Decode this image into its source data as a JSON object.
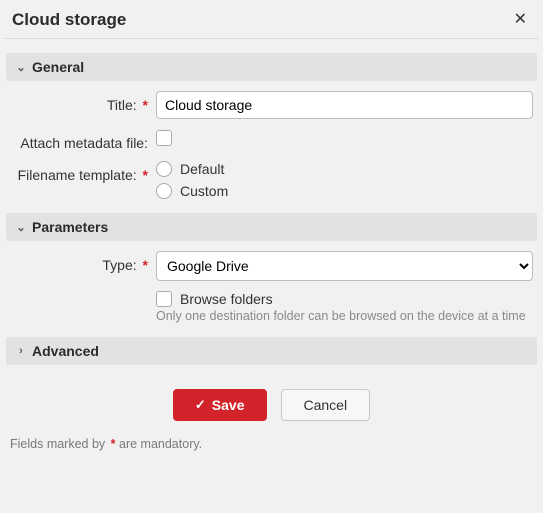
{
  "header": {
    "title": "Cloud storage"
  },
  "sections": {
    "general": {
      "title": "General",
      "expanded": true,
      "fields": {
        "title_label": "Title:",
        "title_value": "Cloud storage",
        "attach_label": "Attach metadata file:",
        "template_label": "Filename template:",
        "template_options": {
          "default": "Default",
          "custom": "Custom"
        }
      }
    },
    "parameters": {
      "title": "Parameters",
      "expanded": true,
      "fields": {
        "type_label": "Type:",
        "type_value": "Google Drive",
        "browse_label": "Browse folders",
        "browse_hint": "Only one destination folder can be browsed on the device at a time"
      }
    },
    "advanced": {
      "title": "Advanced",
      "expanded": false
    }
  },
  "buttons": {
    "save": "Save",
    "cancel": "Cancel"
  },
  "footer": {
    "prefix": "Fields marked by ",
    "marker": "*",
    "suffix": " are mandatory."
  }
}
